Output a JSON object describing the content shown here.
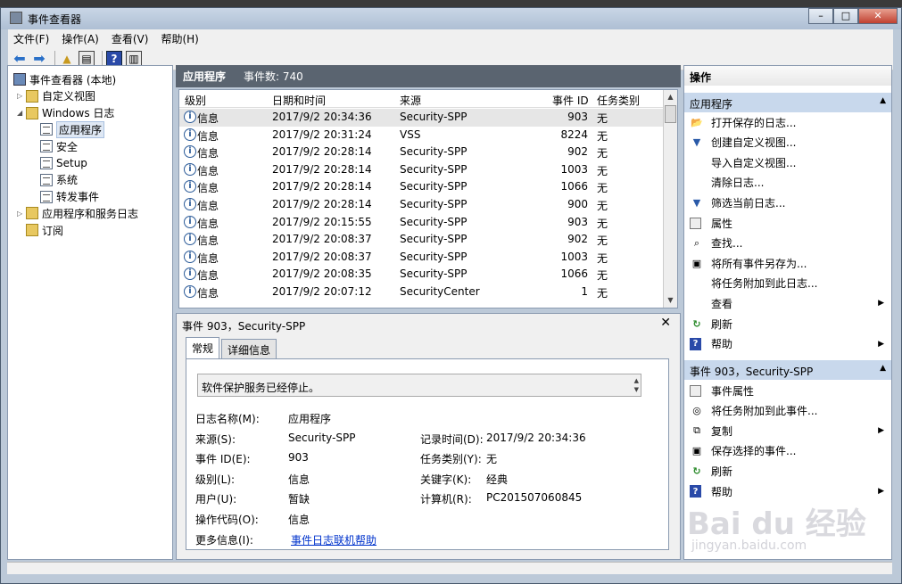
{
  "window": {
    "title": "事件查看器"
  },
  "menu": [
    "文件(F)",
    "操作(A)",
    "查看(V)",
    "帮助(H)"
  ],
  "tree": [
    {
      "label": "事件查看器 (本地)",
      "exp": "",
      "icon": "root",
      "level": 0
    },
    {
      "label": "自定义视图",
      "exp": "▷",
      "icon": "folder",
      "level": 1
    },
    {
      "label": "Windows 日志",
      "exp": "◢",
      "icon": "folder",
      "level": 1
    },
    {
      "label": "应用程序",
      "exp": "",
      "icon": "log",
      "level": 2,
      "selected": true
    },
    {
      "label": "安全",
      "exp": "",
      "icon": "log",
      "level": 2
    },
    {
      "label": "Setup",
      "exp": "",
      "icon": "log",
      "level": 2
    },
    {
      "label": "系统",
      "exp": "",
      "icon": "log",
      "level": 2
    },
    {
      "label": "转发事件",
      "exp": "",
      "icon": "log",
      "level": 2
    },
    {
      "label": "应用程序和服务日志",
      "exp": "▷",
      "icon": "folder",
      "level": 1
    },
    {
      "label": "订阅",
      "exp": "",
      "icon": "sub",
      "level": 1
    }
  ],
  "center": {
    "title": "应用程序",
    "count": "事件数: 740"
  },
  "table": {
    "headers": [
      "级别",
      "日期和时间",
      "来源",
      "事件 ID",
      "任务类别"
    ],
    "rows": [
      [
        "信息",
        "2017/9/2 20:34:36",
        "Security-SPP",
        "903",
        "无"
      ],
      [
        "信息",
        "2017/9/2 20:31:24",
        "VSS",
        "8224",
        "无"
      ],
      [
        "信息",
        "2017/9/2 20:28:14",
        "Security-SPP",
        "902",
        "无"
      ],
      [
        "信息",
        "2017/9/2 20:28:14",
        "Security-SPP",
        "1003",
        "无"
      ],
      [
        "信息",
        "2017/9/2 20:28:14",
        "Security-SPP",
        "1066",
        "无"
      ],
      [
        "信息",
        "2017/9/2 20:28:14",
        "Security-SPP",
        "900",
        "无"
      ],
      [
        "信息",
        "2017/9/2 20:15:55",
        "Security-SPP",
        "903",
        "无"
      ],
      [
        "信息",
        "2017/9/2 20:08:37",
        "Security-SPP",
        "902",
        "无"
      ],
      [
        "信息",
        "2017/9/2 20:08:37",
        "Security-SPP",
        "1003",
        "无"
      ],
      [
        "信息",
        "2017/9/2 20:08:35",
        "Security-SPP",
        "1066",
        "无"
      ],
      [
        "信息",
        "2017/9/2 20:07:12",
        "SecurityCenter",
        "1",
        "无"
      ]
    ]
  },
  "detail": {
    "title": "事件 903，Security-SPP",
    "tabs": [
      "常规",
      "详细信息"
    ],
    "message": "软件保护服务已经停止。",
    "fields": {
      "log_name_label": "日志名称(M):",
      "log_name": "应用程序",
      "source_label": "来源(S):",
      "source": "Security-SPP",
      "logged_label": "记录时间(D):",
      "logged": "2017/9/2 20:34:36",
      "event_id_label": "事件 ID(E):",
      "event_id": "903",
      "task_label": "任务类别(Y):",
      "task": "无",
      "level_label": "级别(L):",
      "level": "信息",
      "keywords_label": "关键字(K):",
      "keywords": "经典",
      "user_label": "用户(U):",
      "user": "暂缺",
      "computer_label": "计算机(R):",
      "computer": "PC201507060845",
      "opcode_label": "操作代码(O):",
      "opcode": "信息",
      "more_label": "更多信息(I):",
      "more_link": "事件日志联机帮助"
    }
  },
  "actions": {
    "header": "操作",
    "section1": "应用程序",
    "items1": [
      {
        "label": "打开保存的日志...",
        "icon": "folder"
      },
      {
        "label": "创建自定义视图...",
        "icon": "filter"
      },
      {
        "label": "导入自定义视图...",
        "icon": ""
      },
      {
        "label": "清除日志...",
        "icon": ""
      },
      {
        "label": "筛选当前日志...",
        "icon": "filter"
      },
      {
        "label": "属性",
        "icon": "box"
      },
      {
        "label": "查找...",
        "icon": "find"
      },
      {
        "label": "将所有事件另存为...",
        "icon": "save"
      },
      {
        "label": "将任务附加到此日志...",
        "icon": ""
      },
      {
        "label": "查看",
        "icon": "",
        "sub": true
      },
      {
        "label": "刷新",
        "icon": "refresh"
      },
      {
        "label": "帮助",
        "icon": "help",
        "sub": true
      }
    ],
    "section2": "事件 903，Security-SPP",
    "items2": [
      {
        "label": "事件属性",
        "icon": "box"
      },
      {
        "label": "将任务附加到此事件...",
        "icon": "task"
      },
      {
        "label": "复制",
        "icon": "copy",
        "sub": true
      },
      {
        "label": "保存选择的事件...",
        "icon": "save"
      },
      {
        "label": "刷新",
        "icon": "refresh"
      },
      {
        "label": "帮助",
        "icon": "help",
        "sub": true
      }
    ]
  },
  "watermark": {
    "logo": "Bai du 经验",
    "url": "jingyan.baidu.com"
  }
}
